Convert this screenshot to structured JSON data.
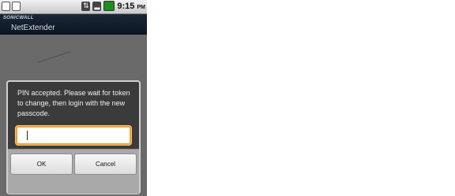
{
  "status_bar": {
    "time": "9:15",
    "ampm": "PM",
    "icons": [
      "sd-card-icon",
      "usb-icon",
      "data-icon",
      "signal-icon",
      "battery-icon"
    ]
  },
  "app": {
    "brand": "SONICWALL",
    "title": "NetExtender"
  },
  "dialog": {
    "message": "PIN accepted. Please wait for token to change, then login with the new passcode.",
    "input_value": "",
    "ok_label": "OK",
    "cancel_label": "Cancel"
  },
  "colors": {
    "input_focus": "#f0a030",
    "titlebar": "#0c1522",
    "dialog_bg": "#3b3b3b"
  }
}
